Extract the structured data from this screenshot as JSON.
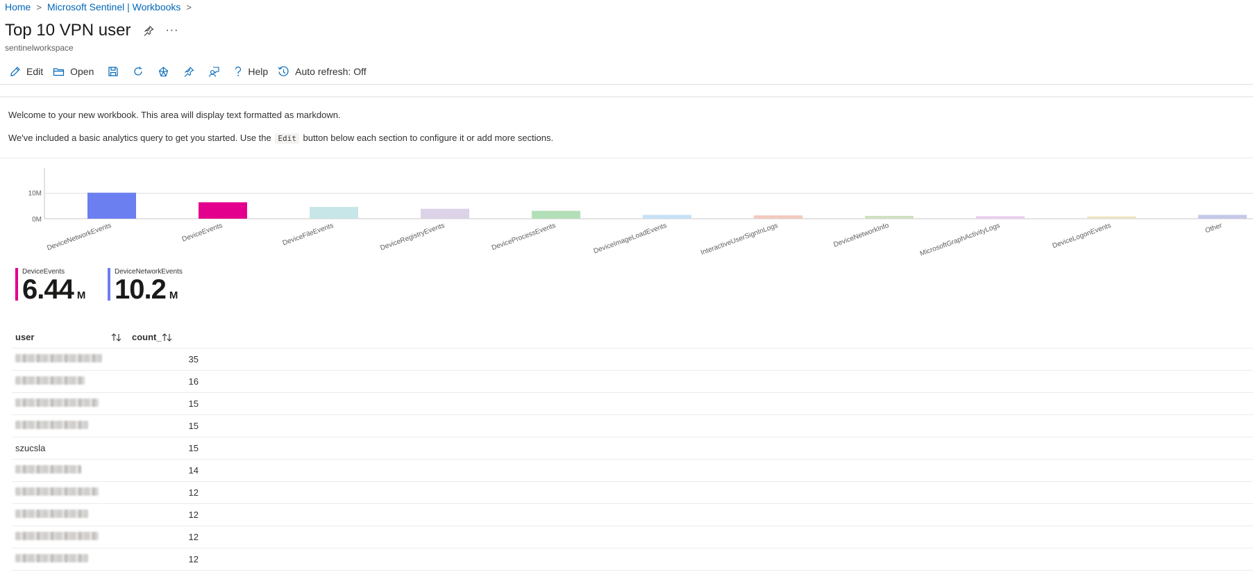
{
  "breadcrumb": {
    "home": "Home",
    "workbooks": "Microsoft Sentinel | Workbooks"
  },
  "page": {
    "title": "Top 10 VPN user",
    "subtitle": "sentinelworkspace"
  },
  "toolbar": {
    "edit": "Edit",
    "open": "Open",
    "help": "Help",
    "auto_refresh": "Auto refresh: Off"
  },
  "markdown": {
    "line1": "Welcome to your new workbook. This area will display text formatted as markdown.",
    "line2_before": "We've included a basic analytics query to get you started. Use the",
    "line2_code": "Edit",
    "line2_after": "button below each section to configure it or add more sections."
  },
  "chart_data": {
    "type": "bar",
    "categories": [
      "DeviceNetworkEvents",
      "DeviceEvents",
      "DeviceFileEvents",
      "DeviceRegistryEvents",
      "DeviceProcessEvents",
      "DeviceImageLoadEvents",
      "InteractiveUserSignInLogs",
      "DeviceNetworkInfo",
      "MicrosoftGraphActivityLogs",
      "DeviceLogonEvents",
      "Other"
    ],
    "values": [
      10.2,
      6.44,
      4.6,
      3.9,
      3.1,
      1.5,
      1.3,
      1.1,
      1.0,
      0.9,
      1.5
    ],
    "colors": [
      "#6b7ff0",
      "#e3008c",
      "#c6e6e7",
      "#dcd3e8",
      "#b3dfb8",
      "#c7e0f4",
      "#f2c9bf",
      "#cfe1c2",
      "#eccff0",
      "#ece4c4",
      "#c5c8e8"
    ],
    "ylabel": "",
    "ytick_labels": [
      "0M",
      "10M"
    ],
    "ylim": [
      0,
      15
    ],
    "grid": true
  },
  "tiles": [
    {
      "label": "DeviceEvents",
      "value": "6.44",
      "unit": "M",
      "color": "#e3008c"
    },
    {
      "label": "DeviceNetworkEvents",
      "value": "10.2",
      "unit": "M",
      "color": "#6b7ff0"
    }
  ],
  "grid": {
    "headers": {
      "user": "user",
      "count": "count_"
    },
    "rows": [
      {
        "user": "",
        "count": "35"
      },
      {
        "user": "",
        "count": "16"
      },
      {
        "user": "",
        "count": "15"
      },
      {
        "user": "",
        "count": "15"
      },
      {
        "user": "szucsla",
        "count": "15"
      },
      {
        "user": "",
        "count": "14"
      },
      {
        "user": "",
        "count": "12"
      },
      {
        "user": "",
        "count": "12"
      },
      {
        "user": "",
        "count": "12"
      },
      {
        "user": "",
        "count": "12"
      }
    ]
  }
}
